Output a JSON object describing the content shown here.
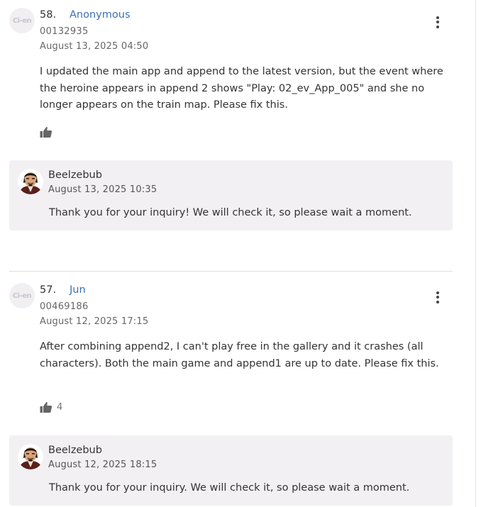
{
  "comments": [
    {
      "number": "58.",
      "user": "Anonymous",
      "user_id": "00132935",
      "date": "August 13, 2025 04:50",
      "avatar_text": "Ci-en",
      "body": "I updated the main app and append to the latest version, but the event where the heroine appears in append 2 shows \"Play: 02_ev_App_005\" and she no longer appears on the train map. Please fix this.",
      "likes": "",
      "reply": {
        "author": "Beelzebub",
        "date": "August 13, 2025 10:35",
        "body": "Thank you for your inquiry! We will check it, so please wait a moment."
      }
    },
    {
      "number": "57.",
      "user": "Jun",
      "user_id": "00469186",
      "date": "August 12, 2025 17:15",
      "avatar_text": "Ci-en",
      "body": "After combining append2, I can't play free in the gallery and it crashes (all characters). Both the main game and append1 are up to date. Please fix this.",
      "likes": "4",
      "reply": {
        "author": "Beelzebub",
        "date": "August 12, 2025 18:15",
        "body": "Thank you for your inquiry. We will check it, so please wait a moment."
      }
    }
  ],
  "icons": {
    "menu": "kebab-menu-icon",
    "like": "thumbs-up-icon",
    "reply_avatar": "creator-avatar"
  },
  "colors": {
    "user_link": "#3d6fb6",
    "reply_bg": "#f2f0f3",
    "divider": "#dddddd"
  }
}
